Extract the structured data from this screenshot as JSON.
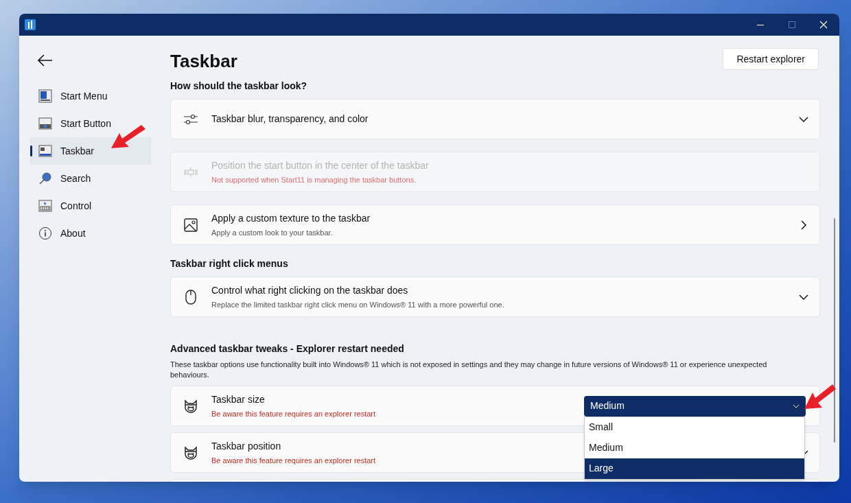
{
  "sidebar": {
    "items": [
      {
        "label": "Start Menu",
        "selected": false
      },
      {
        "label": "Start Button",
        "selected": false
      },
      {
        "label": "Taskbar",
        "selected": true
      },
      {
        "label": "Search",
        "selected": false
      },
      {
        "label": "Control",
        "selected": false
      },
      {
        "label": "About",
        "selected": false
      }
    ]
  },
  "header": {
    "title": "Taskbar",
    "button": "Restart explorer"
  },
  "sections": [
    {
      "heading": "How should the taskbar look?",
      "cards": [
        {
          "kind": "expander",
          "title": "Taskbar blur, transparency, and color"
        },
        {
          "kind": "info",
          "title": "Position the start button in the center of the taskbar",
          "subtitle": "Not supported when Start11 is managing the taskbar buttons.",
          "disabled": true
        },
        {
          "kind": "link",
          "title": "Apply a custom texture to the taskbar",
          "subtitle": "Apply a custom look to your taskbar."
        }
      ]
    },
    {
      "heading": "Taskbar right click menus",
      "cards": [
        {
          "kind": "expander",
          "title": "Control what right clicking on the taskbar does",
          "subtitle": "Replace the limited taskbar right click menu on Windows® 11 with a more powerful one."
        }
      ]
    },
    {
      "heading": "Advanced taskbar tweaks - Explorer restart needed",
      "description": "These taskbar options use functionality built into Windows® 11 which is not exposed in settings and they may change in future versions of Windows® 11 or experience unexpected behaviours.",
      "cards": [
        {
          "kind": "dropdown",
          "title": "Taskbar size",
          "subtitle": "Be aware this feature requires an explorer restart",
          "dropdown": {
            "value": "Medium",
            "expanded": true,
            "options": [
              {
                "label": "Small",
                "highlighted": false
              },
              {
                "label": "Medium",
                "highlighted": false
              },
              {
                "label": "Large",
                "highlighted": true
              }
            ]
          }
        },
        {
          "kind": "tweak",
          "title": "Taskbar position",
          "subtitle": "Be aware this feature requires an explorer restart"
        },
        {
          "kind": "blank"
        }
      ]
    }
  ]
}
